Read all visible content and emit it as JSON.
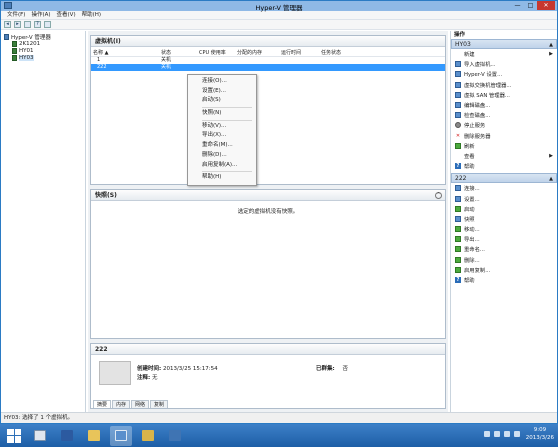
{
  "window": {
    "title": "Hyper-V 管理器"
  },
  "menu": [
    "文件(F)",
    "操作(A)",
    "查看(V)",
    "帮助(H)"
  ],
  "tree": {
    "root": "Hyper-V 管理器",
    "servers": [
      "2K1201",
      "HY01",
      "HY03"
    ]
  },
  "vm_panel": {
    "title": "虚拟机(I)",
    "columns": [
      "名称",
      "状态",
      "CPU 使用率",
      "分配的内存",
      "运行时间",
      "任务状态"
    ],
    "rows": [
      {
        "name": "1",
        "state": "关机"
      },
      {
        "name": "222",
        "state": "关机"
      }
    ]
  },
  "context_menu": {
    "items": [
      "连接(O)...",
      "设置(E)...",
      "启动(S)",
      "快照(N)",
      "移动(V)...",
      "导出(X)...",
      "重命名(M)...",
      "删除(D)...",
      "启用复制(A)...",
      "帮助(H)"
    ]
  },
  "snapshot_panel": {
    "title": "快照(S)",
    "message": "选定的虚拟机没有快照。"
  },
  "detail_panel": {
    "title": "222",
    "created_label": "创建时间:",
    "created_value": "2013/3/25 15:17:54",
    "notes_label": "注释:",
    "notes_value": "无",
    "clustered_label": "已群集:",
    "clustered_value": "否",
    "tabs": [
      "摘要",
      "内存",
      "网络",
      "复制"
    ]
  },
  "actions": {
    "title": "操作",
    "server_section": "HY03",
    "server_items": [
      {
        "label": "新建",
        "icon": "new-icon",
        "submenu": true
      },
      {
        "label": "导入虚拟机...",
        "icon": "import-icon"
      },
      {
        "label": "Hyper-V 设置...",
        "icon": "settings-icon"
      },
      {
        "label": "虚拟交换机管理器...",
        "icon": "switch-manager-icon"
      },
      {
        "label": "虚拟 SAN 管理器...",
        "icon": "san-manager-icon"
      },
      {
        "label": "编辑磁盘...",
        "icon": "edit-disk-icon"
      },
      {
        "label": "检查磁盘...",
        "icon": "inspect-disk-icon"
      },
      {
        "label": "停止服务",
        "icon": "stop-service-icon"
      },
      {
        "label": "删除服务器",
        "icon": "remove-server-icon"
      },
      {
        "label": "刷新",
        "icon": "refresh-icon"
      },
      {
        "label": "查看",
        "icon": "view-icon",
        "submenu": true
      },
      {
        "label": "帮助",
        "icon": "help-icon"
      }
    ],
    "vm_section": "222",
    "vm_items": [
      {
        "label": "连接...",
        "icon": "connect-icon"
      },
      {
        "label": "设置...",
        "icon": "settings-icon"
      },
      {
        "label": "启动",
        "icon": "start-icon"
      },
      {
        "label": "快照",
        "icon": "snapshot-icon"
      },
      {
        "label": "移动...",
        "icon": "move-icon"
      },
      {
        "label": "导出...",
        "icon": "export-icon"
      },
      {
        "label": "重命名...",
        "icon": "rename-icon"
      },
      {
        "label": "删除...",
        "icon": "delete-icon"
      },
      {
        "label": "启用复制...",
        "icon": "replication-icon"
      },
      {
        "label": "帮助",
        "icon": "help-icon"
      }
    ]
  },
  "status": "HY03:  选择了 1 个虚拟机。",
  "clock": {
    "time": "9:09",
    "date": "2013/3/26"
  },
  "colors": {
    "accent": "#3399ff",
    "taskbar": "#1d5ea6",
    "close": "#c7372f"
  }
}
